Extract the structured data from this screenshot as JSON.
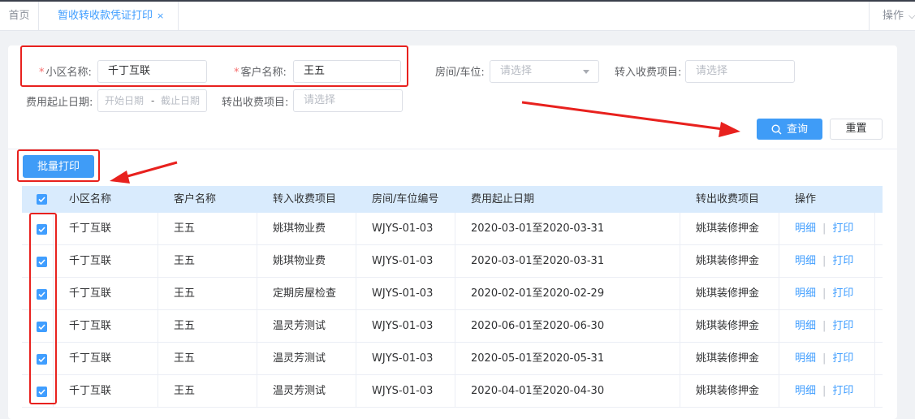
{
  "tabs": {
    "home": "首页",
    "active": "暂收转收款凭证打印",
    "close": "×",
    "operations": "操作"
  },
  "form": {
    "community_label": "小区名称",
    "community_value": "千丁互联",
    "customer_label": "客户名称",
    "customer_value": "王五",
    "room_label": "房间/车位",
    "room_placeholder": "请选择",
    "in_item_label": "转入收费项目",
    "in_item_placeholder": "请选择",
    "date_label": "费用起止日期",
    "date_start_placeholder": "开始日期",
    "date_sep": "-",
    "date_end_placeholder": "截止日期",
    "out_item_label": "转出收费项目",
    "out_item_placeholder": "请选择",
    "required_mark": "*",
    "colon": ":"
  },
  "buttons": {
    "query": "查询",
    "reset": "重置",
    "batch_print": "批量打印"
  },
  "table": {
    "columns": [
      "小区名称",
      "客户名称",
      "转入收费项目",
      "房间/车位编号",
      "费用起止日期",
      "转出收费项目",
      "操作"
    ],
    "rows": [
      {
        "community": "千丁互联",
        "customer": "王五",
        "in_item": "姚琪物业费",
        "room": "WJYS-01-03",
        "date_range": "2020-03-01至2020-03-31",
        "out_item": "姚琪装修押金",
        "detail": "明细",
        "print": "打印"
      },
      {
        "community": "千丁互联",
        "customer": "王五",
        "in_item": "姚琪物业费",
        "room": "WJYS-01-03",
        "date_range": "2020-03-01至2020-03-31",
        "out_item": "姚琪装修押金",
        "detail": "明细",
        "print": "打印"
      },
      {
        "community": "千丁互联",
        "customer": "王五",
        "in_item": "定期房屋检查",
        "room": "WJYS-01-03",
        "date_range": "2020-02-01至2020-02-29",
        "out_item": "姚琪装修押金",
        "detail": "明细",
        "print": "打印"
      },
      {
        "community": "千丁互联",
        "customer": "王五",
        "in_item": "温灵芳测试",
        "room": "WJYS-01-03",
        "date_range": "2020-06-01至2020-06-30",
        "out_item": "姚琪装修押金",
        "detail": "明细",
        "print": "打印"
      },
      {
        "community": "千丁互联",
        "customer": "王五",
        "in_item": "温灵芳测试",
        "room": "WJYS-01-03",
        "date_range": "2020-05-01至2020-05-31",
        "out_item": "姚琪装修押金",
        "detail": "明细",
        "print": "打印"
      },
      {
        "community": "千丁互联",
        "customer": "王五",
        "in_item": "温灵芳测试",
        "room": "WJYS-01-03",
        "date_range": "2020-04-01至2020-04-30",
        "out_item": "姚琪装修押金",
        "detail": "明细",
        "print": "打印"
      }
    ],
    "action_sep": "|"
  },
  "colors": {
    "accent": "#409eff",
    "annotation_red": "#e8211e",
    "header_bg": "#d9ebfd"
  }
}
